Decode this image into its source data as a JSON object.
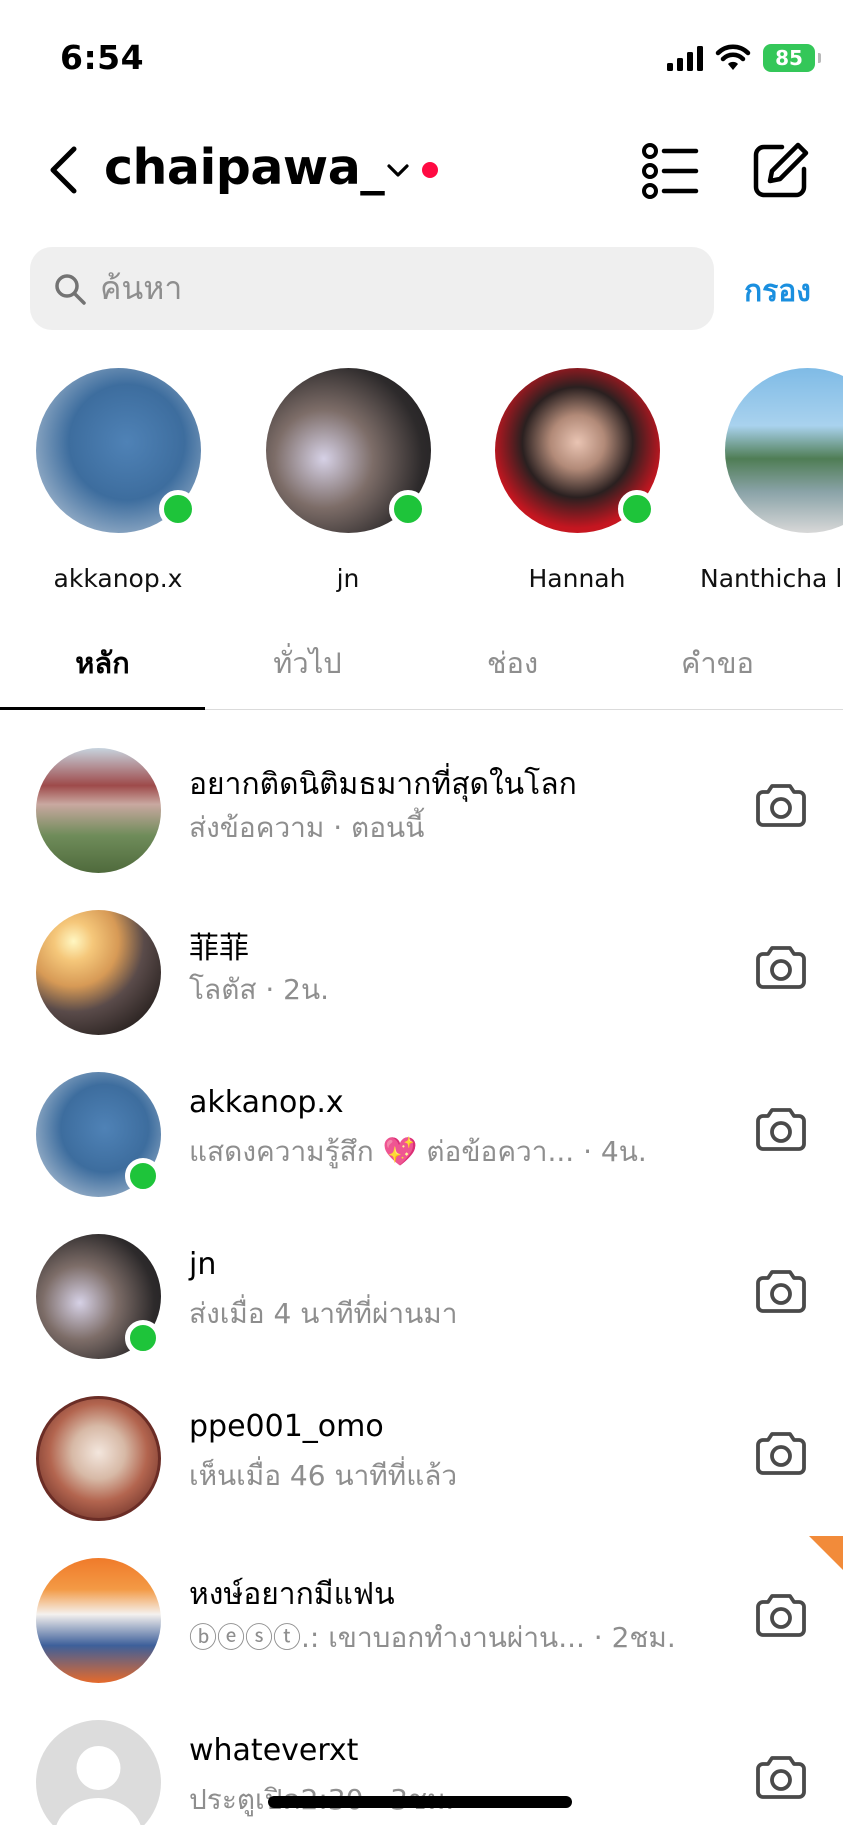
{
  "status_bar": {
    "time": "6:54",
    "battery": "85"
  },
  "header": {
    "account_name": "chaipawa_"
  },
  "search": {
    "placeholder": "ค้นหา",
    "filter_label": "กรอง"
  },
  "notes": [
    {
      "name": "akkanop.x",
      "online": true
    },
    {
      "name": "jn",
      "online": true
    },
    {
      "name": "Hannah",
      "online": true
    },
    {
      "name": "Nanthicha l",
      "online": false
    }
  ],
  "tabs": [
    {
      "label": "หลัก",
      "active": true
    },
    {
      "label": "ทั่วไป",
      "active": false
    },
    {
      "label": "ช่อง",
      "active": false
    },
    {
      "label": "คำขอ",
      "active": false
    }
  ],
  "threads": [
    {
      "name": "อยากติดนิติมธมากที่สุดในโลก",
      "preview": "ส่งข้อความ · ตอนนี้",
      "online": false
    },
    {
      "name": "菲菲",
      "preview": "โลตัส · 2น.",
      "online": false
    },
    {
      "name": "akkanop.x",
      "preview": "แสดงความรู้สึก 💖 ต่อข้อควา...   · 4น.",
      "online": true
    },
    {
      "name": "jn",
      "preview": "ส่งเมื่อ 4 นาทีที่ผ่านมา",
      "online": true
    },
    {
      "name": "ppe001_omo",
      "preview": "เห็นเมื่อ 46 นาทีที่แล้ว",
      "online": false
    },
    {
      "name": "หงษ์อยากมีแฟน",
      "preview": "ⓑⓔⓢⓣ.: เขาบอกทำงานผ่าน... · 2ชม.",
      "online": false
    },
    {
      "name": "whateverxt",
      "preview": "ประตูเปิด2:30 · 3ชม.",
      "online": false
    }
  ],
  "colors": {
    "accent": "#1a8fdf",
    "online": "#1ec43a",
    "unread_dot": "#ff0a42",
    "battery": "#34c759"
  },
  "icons": [
    "back-chevron-icon",
    "chevron-down-icon",
    "list-icon",
    "compose-icon",
    "search-icon",
    "camera-icon"
  ]
}
